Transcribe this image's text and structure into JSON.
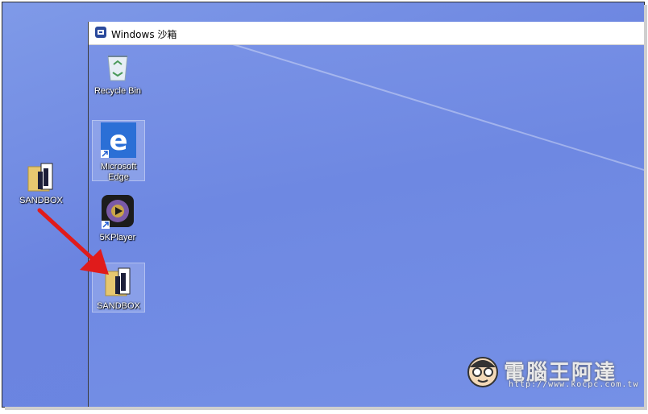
{
  "host_desktop": {
    "icons": [
      {
        "label": "SANDBOX",
        "icon": "sandbox-folder-icon"
      }
    ]
  },
  "sandbox_window": {
    "title": "Windows 沙箱",
    "app_icon": "windows-sandbox-icon",
    "desktop_icons": [
      {
        "label": "Recycle Bin",
        "icon": "recycle-bin-icon"
      },
      {
        "label": "Microsoft Edge",
        "label_line1": "Microsoft",
        "label_line2": "Edge",
        "icon": "edge-icon"
      },
      {
        "label": "5KPlayer",
        "icon": "5kplayer-icon"
      },
      {
        "label": "SANDBOX",
        "icon": "sandbox-folder-icon"
      }
    ]
  },
  "annotation": {
    "arrow_color": "#e01b1b"
  },
  "watermark": {
    "text": "電腦王阿達",
    "url": "http://www.kocpc.com.tw"
  },
  "colors": {
    "desktop_blue": "#6e88e2",
    "titlebar": "#ffffff",
    "edge_blue": "#2b6fd6"
  }
}
